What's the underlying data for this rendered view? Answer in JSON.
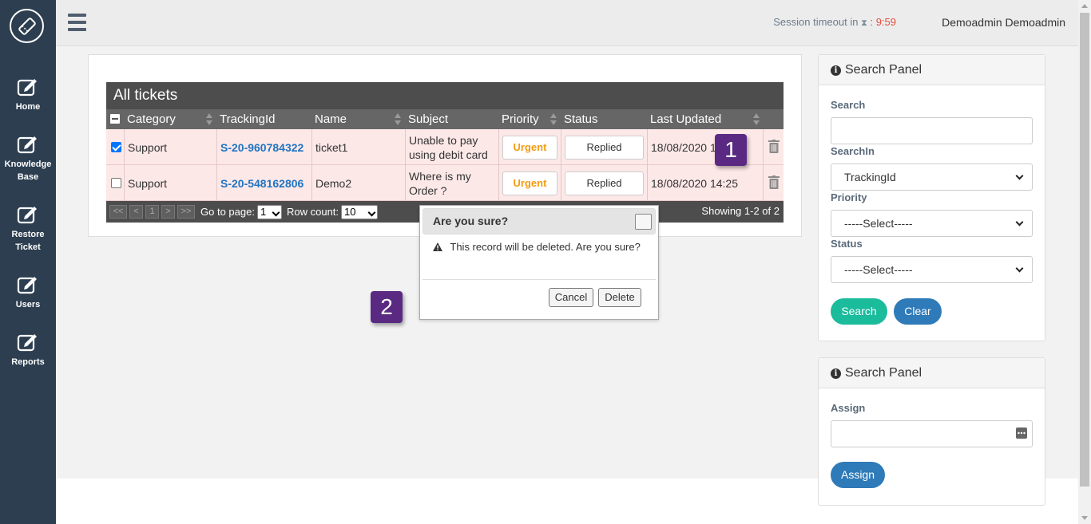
{
  "sidebar": {
    "items": [
      {
        "label": "Home"
      },
      {
        "label": "Knowledge Base"
      },
      {
        "label": "Restore Ticket"
      },
      {
        "label": "Users"
      },
      {
        "label": "Reports"
      }
    ]
  },
  "topbar": {
    "session_label": "Session timeout in",
    "session_sep": ":",
    "session_time": "9:59",
    "user": "Demoadmin Demoadmin"
  },
  "grid": {
    "title": "All tickets",
    "columns": [
      "Category",
      "TrackingId",
      "Name",
      "Subject",
      "Priority",
      "Status",
      "Last Updated"
    ],
    "rows": [
      {
        "checked": true,
        "category": "Support",
        "tracking": "S-20-960784322",
        "name": "ticket1",
        "subject": "Unable to pay using debit card",
        "priority": "Urgent",
        "status": "Replied",
        "updated": "18/08/2020 1"
      },
      {
        "checked": false,
        "category": "Support",
        "tracking": "S-20-548162806",
        "name": "Demo2",
        "subject": "Where is my Order ?",
        "priority": "Urgent",
        "status": "Replied",
        "updated": "18/08/2020 14:25"
      }
    ],
    "pager": {
      "first": "<<",
      "prev": "<",
      "page": "1",
      "next": ">",
      "last": ">>",
      "goto_label": "Go to page:",
      "goto_value": "1",
      "rowcount_label": "Row count:",
      "rowcount_value": "10",
      "showing": "Showing 1-2 of 2"
    }
  },
  "markers": {
    "m1": "1",
    "m2": "2"
  },
  "dialog": {
    "title": "Are you sure?",
    "message": "This record will be deleted. Are you sure?",
    "cancel": "Cancel",
    "delete": "Delete"
  },
  "search_panel": {
    "title": "Search Panel",
    "search_label": "Search",
    "search_value": "",
    "searchin_label": "SearchIn",
    "searchin_value": "TrackingId",
    "priority_label": "Priority",
    "priority_value": "-----Select-----",
    "status_label": "Status",
    "status_value": "-----Select-----",
    "search_btn": "Search",
    "clear_btn": "Clear"
  },
  "assign_panel": {
    "title": "Search Panel",
    "assign_label": "Assign",
    "assign_btn": "Assign"
  },
  "colors": {
    "sidebar": "#2c3e50",
    "session_time": "#e74c3c",
    "link": "#1f74c2",
    "urgent": "#f39c12",
    "search_btn": "#1abc9c",
    "clear_btn": "#2f7ab8",
    "marker": "#5a2a82"
  }
}
